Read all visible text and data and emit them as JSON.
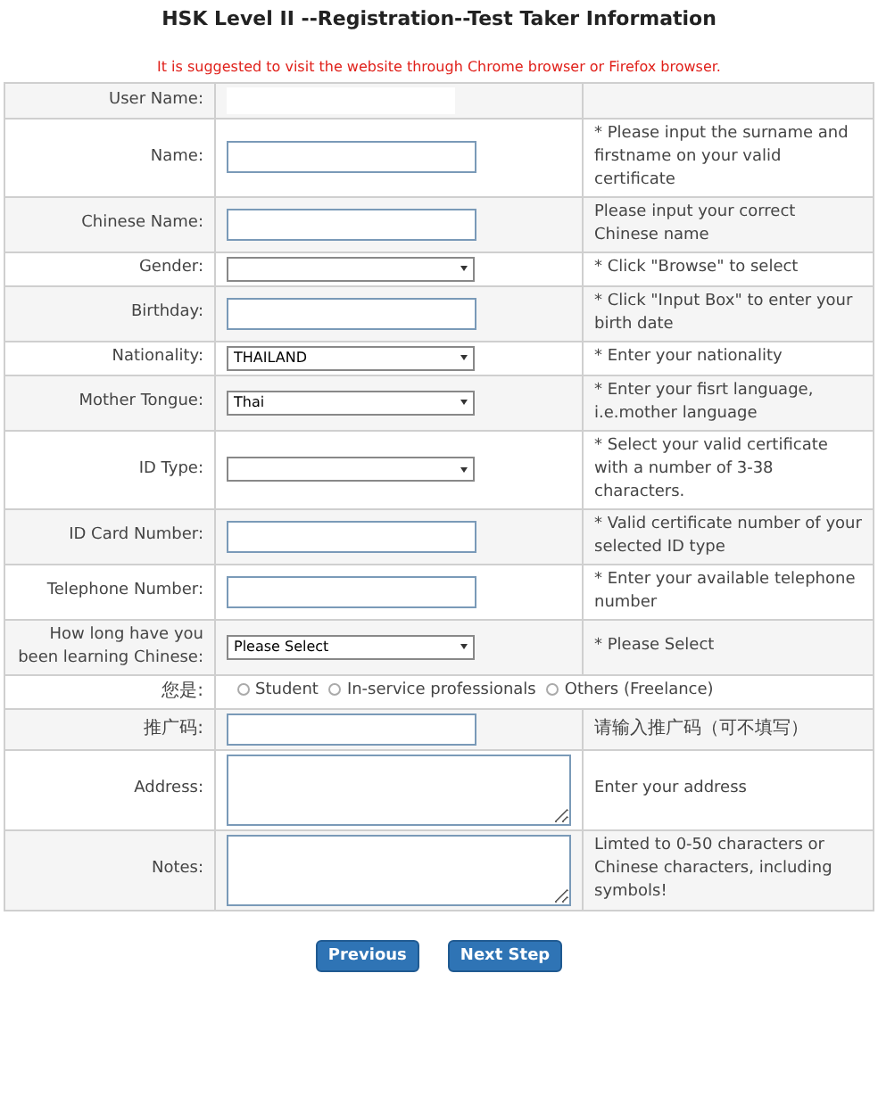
{
  "title": "HSK Level II --Registration--Test Taker Information",
  "notice": "It is suggested to visit the website through Chrome browser or Firefox browser.",
  "rows": [
    {
      "label": "User Name:",
      "kind": "static"
    },
    {
      "label": "Name:",
      "kind": "input",
      "note": "* Please input the surname and firstname on your valid certificate"
    },
    {
      "label": "Chinese Name:",
      "kind": "input",
      "note": "Please input your correct Chinese name"
    },
    {
      "label": "Gender:",
      "kind": "select",
      "note": "* Click \"Browse\" to select"
    },
    {
      "label": "Birthday:",
      "kind": "input",
      "note": "* Click \"Input Box\" to enter your birth date"
    },
    {
      "label": "Nationality:",
      "kind": "select",
      "value": "THAILAND",
      "note": "* Enter your nationality"
    },
    {
      "label": "Mother Tongue:",
      "kind": "select",
      "value": "Thai",
      "note": "* Enter your fisrt language, i.e.mother language"
    },
    {
      "label": "ID Type:",
      "kind": "select",
      "note": "* Select your valid certificate with a number of 3-38 characters."
    },
    {
      "label": "ID Card Number:",
      "kind": "input",
      "note": "* Valid certificate number of your selected ID type"
    },
    {
      "label": "Telephone Number:",
      "kind": "input",
      "note": "* Enter your available telephone number"
    },
    {
      "label": "How long have you been learning Chinese:",
      "kind": "select",
      "value": "Please Select",
      "note": "* Please Select"
    },
    {
      "label": "您是:",
      "kind": "radio",
      "options": [
        {
          "label": "Student",
          "selected": false
        },
        {
          "label": "In-service professionals",
          "selected": false
        },
        {
          "label": "Others (Freelance)",
          "selected": false
        }
      ]
    },
    {
      "label": "推广码:",
      "kind": "input",
      "note": "请输入推广码（可不填写）"
    },
    {
      "label": "Address:",
      "kind": "textarea",
      "note": "Enter your address"
    },
    {
      "label": "Notes:",
      "kind": "textarea",
      "note": "Limted to 0-50 characters or Chinese characters, including symbols!"
    }
  ],
  "buttons": [
    "Previous",
    "Next Step"
  ]
}
